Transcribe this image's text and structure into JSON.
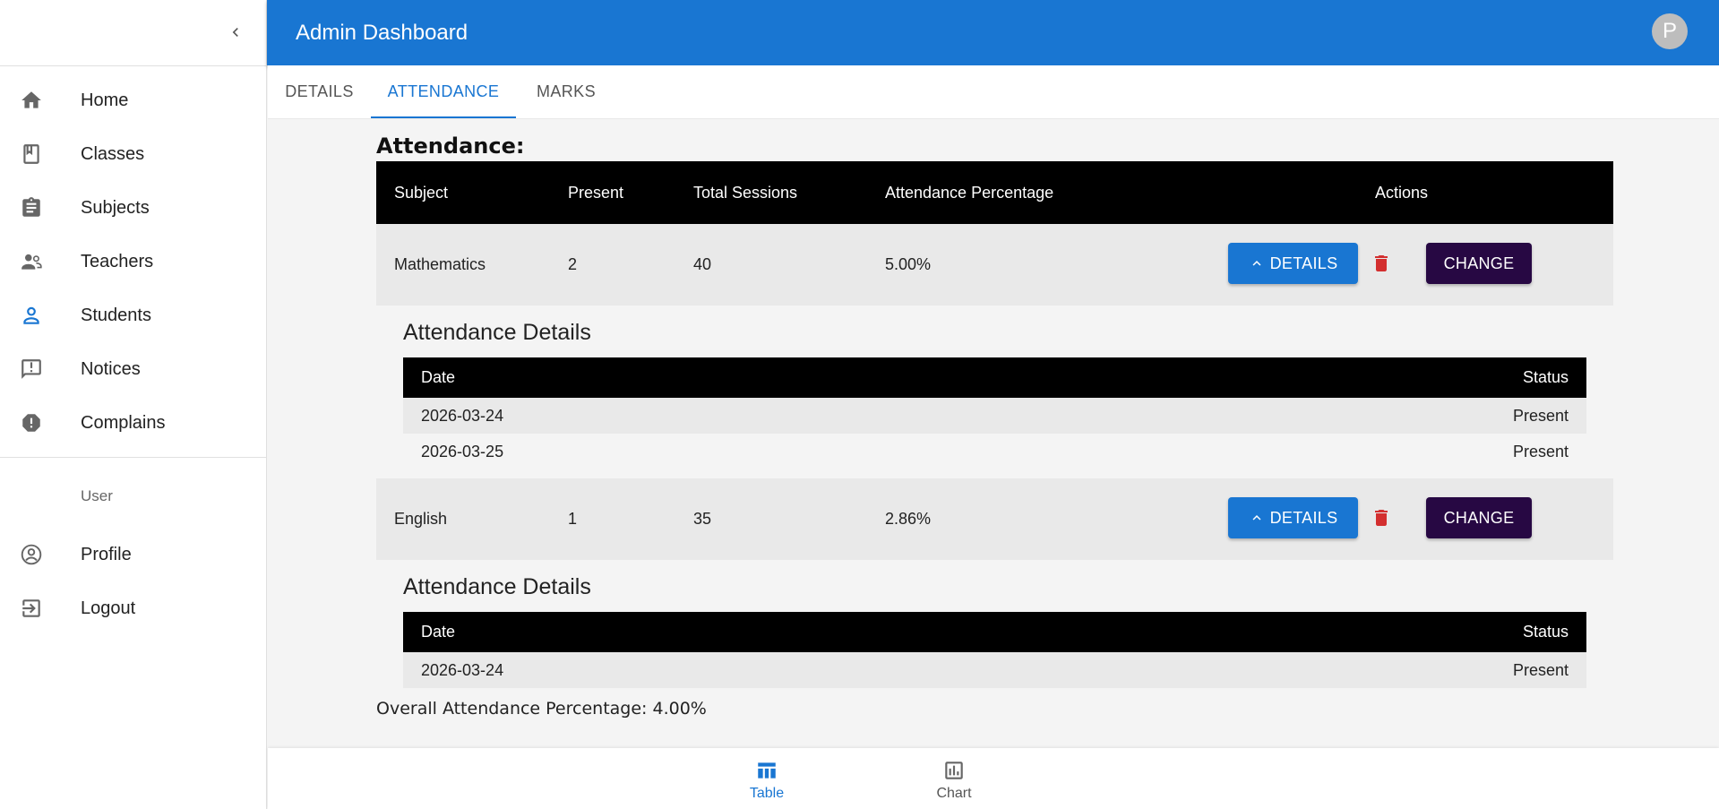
{
  "header": {
    "title": "Admin Dashboard",
    "avatar_initial": "P"
  },
  "sidebar": {
    "items": [
      {
        "label": "Home",
        "icon": "home-icon"
      },
      {
        "label": "Classes",
        "icon": "book-icon"
      },
      {
        "label": "Subjects",
        "icon": "clipboard-icon"
      },
      {
        "label": "Teachers",
        "icon": "people-icon"
      },
      {
        "label": "Students",
        "icon": "person-icon"
      },
      {
        "label": "Notices",
        "icon": "announcement-icon"
      },
      {
        "label": "Complains",
        "icon": "alert-icon"
      }
    ],
    "section_label": "User",
    "user_items": [
      {
        "label": "Profile",
        "icon": "account-circle-icon"
      },
      {
        "label": "Logout",
        "icon": "logout-icon"
      }
    ]
  },
  "tabs": [
    {
      "label": "DETAILS"
    },
    {
      "label": "ATTENDANCE"
    },
    {
      "label": "MARKS"
    }
  ],
  "attendance": {
    "title": "Attendance:",
    "columns": [
      "Subject",
      "Present",
      "Total Sessions",
      "Attendance Percentage",
      "Actions"
    ],
    "rows": [
      {
        "subject": "Mathematics",
        "present": "2",
        "total": "40",
        "percentage": "5.00%",
        "details_label": "DETAILS",
        "change_label": "CHANGE",
        "details_title": "Attendance Details",
        "details_columns": [
          "Date",
          "Status"
        ],
        "details": [
          {
            "date": "2026-03-24",
            "status": "Present"
          },
          {
            "date": "2026-03-25",
            "status": "Present"
          }
        ]
      },
      {
        "subject": "English",
        "present": "1",
        "total": "35",
        "percentage": "2.86%",
        "details_label": "DETAILS",
        "change_label": "CHANGE",
        "details_title": "Attendance Details",
        "details_columns": [
          "Date",
          "Status"
        ],
        "details": [
          {
            "date": "2026-03-24",
            "status": "Present"
          }
        ]
      }
    ],
    "overall": "Overall Attendance Percentage: 4.00%"
  },
  "bottom_nav": [
    {
      "label": "Table",
      "icon": "table-icon"
    },
    {
      "label": "Chart",
      "icon": "bar-chart-icon"
    }
  ],
  "colors": {
    "primary": "#1976d2",
    "change_button": "#270843",
    "delete": "#d32f2f"
  }
}
